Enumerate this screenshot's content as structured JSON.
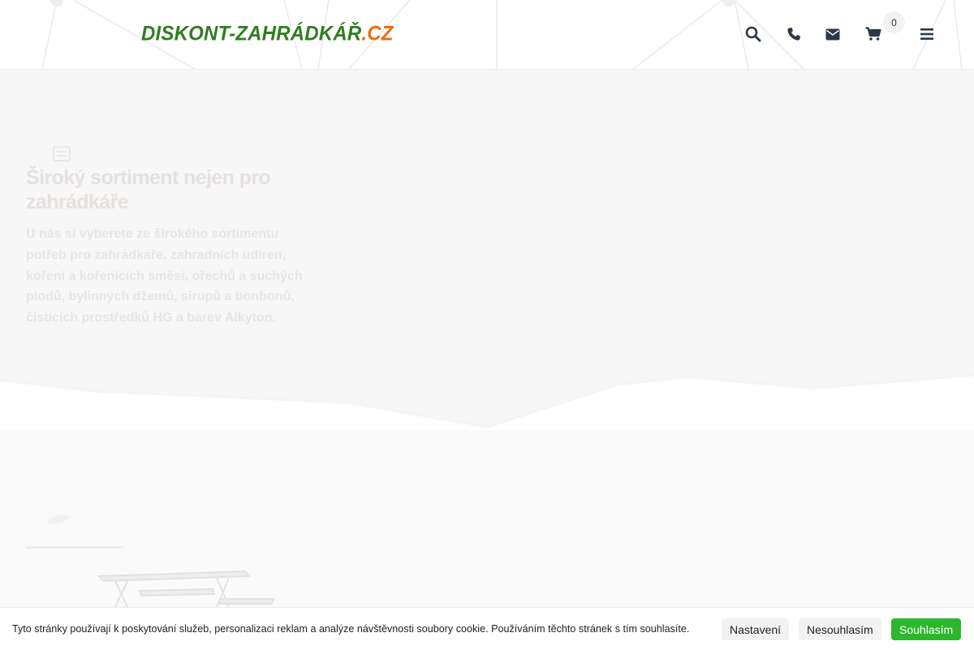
{
  "header": {
    "logo": {
      "part1": "DISKONT-ZAHRÁDKÁŘ",
      "part2": ".CZ"
    },
    "icons": [
      "search-icon",
      "phone-icon",
      "envelope-icon",
      "cart-icon",
      "menu-icon"
    ],
    "cart_count": "0"
  },
  "hero": {
    "title": "Široký sortiment nejen pro zahrádkáře",
    "text": "U nás si vyberete ze širokého sortimentu potřeb pro zahrádkáře, zahradních udíren, koření a kořenících směsí, ořechů a suchých plodů, bylinných džemů, sirupů a bonbonů, čistících prostředků HG a barev Alkyton."
  },
  "cookie_bar": {
    "text": "Tyto stránky používají k poskytování služeb, personalizaci reklam a analýze návštěvnosti soubory cookie. Používáním těchto stránek s tím souhlasíte.",
    "settings_label": "Nastavení",
    "decline_label": "Nesouhlasím",
    "accept_label": "Souhlasím"
  },
  "colors": {
    "logo_green": "#2f7d1f",
    "logo_orange": "#f26a10",
    "accept_green": "#2cb72c",
    "icon_dark": "#2b3a4a"
  }
}
